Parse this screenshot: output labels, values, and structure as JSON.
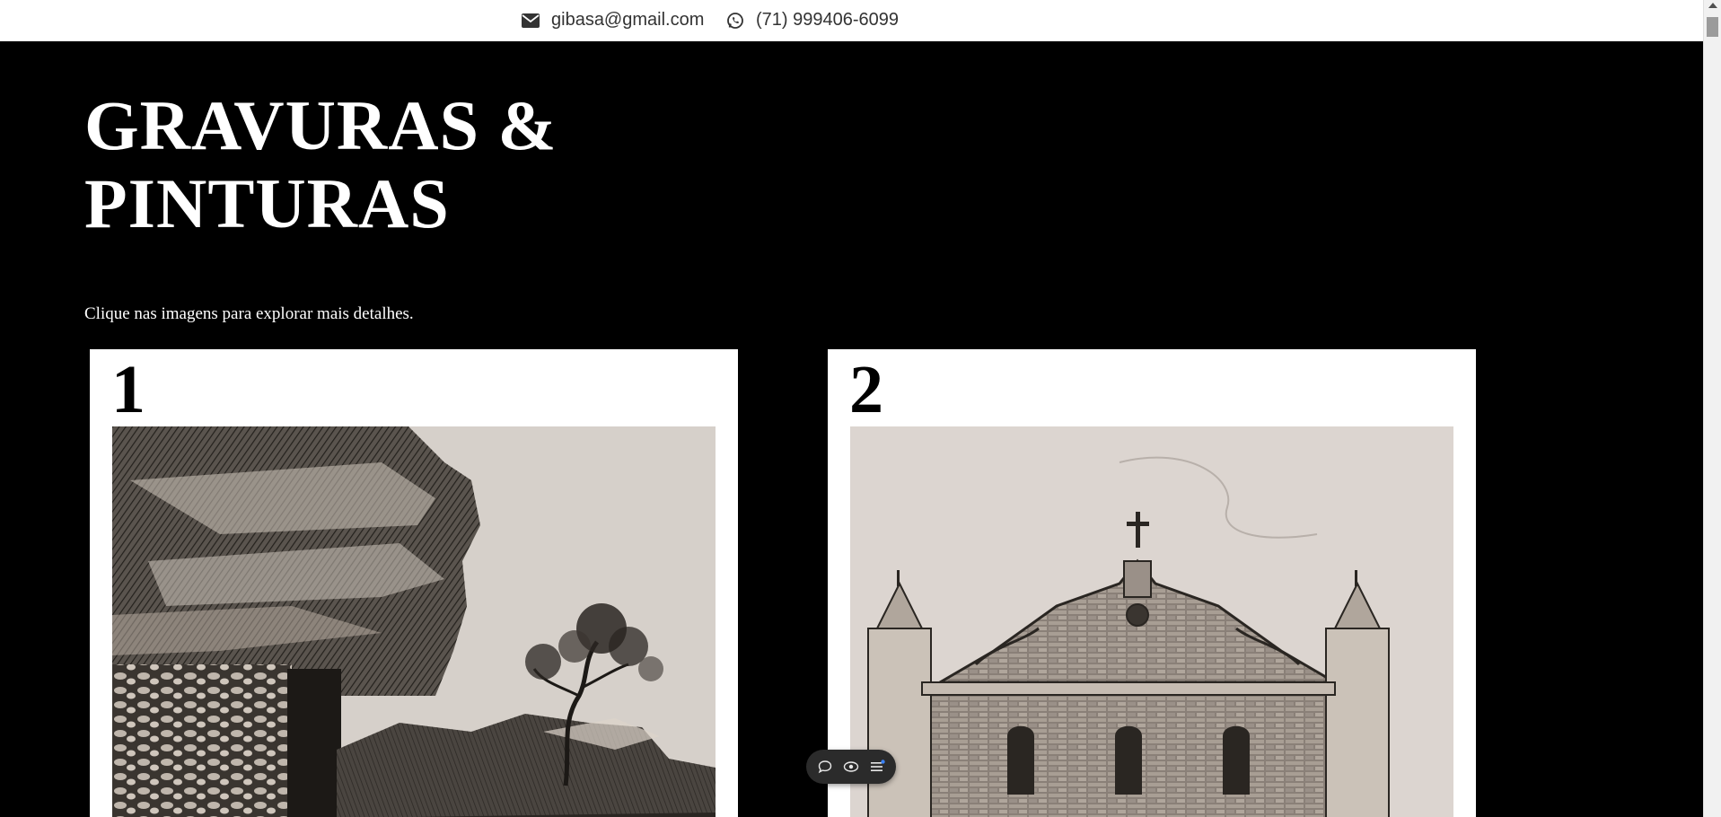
{
  "topbar": {
    "email": "gibasa@gmail.com",
    "phone": "(71) 999406-6099",
    "email_icon": "envelope-icon",
    "phone_icon": "whatsapp-icon"
  },
  "hero": {
    "title_line1": "GRAVURAS &",
    "title_line2": "PINTURAS",
    "hint": "Clique nas imagens para explorar mais detalhes."
  },
  "gallery": [
    {
      "number": "1",
      "subject": "rocky cliff with stone wall and tree etching"
    },
    {
      "number": "2",
      "subject": "colonial church facade etching"
    }
  ],
  "toolbar": {
    "icons": [
      "comment-icon",
      "eye-icon",
      "menu-icon"
    ]
  },
  "colors": {
    "background": "#000000",
    "topbar": "#ffffff",
    "text_light": "#ffffff",
    "text_dark": "#333333",
    "toolbar_bg": "#2b2b2b",
    "toolbar_badge": "#3b82f6"
  }
}
